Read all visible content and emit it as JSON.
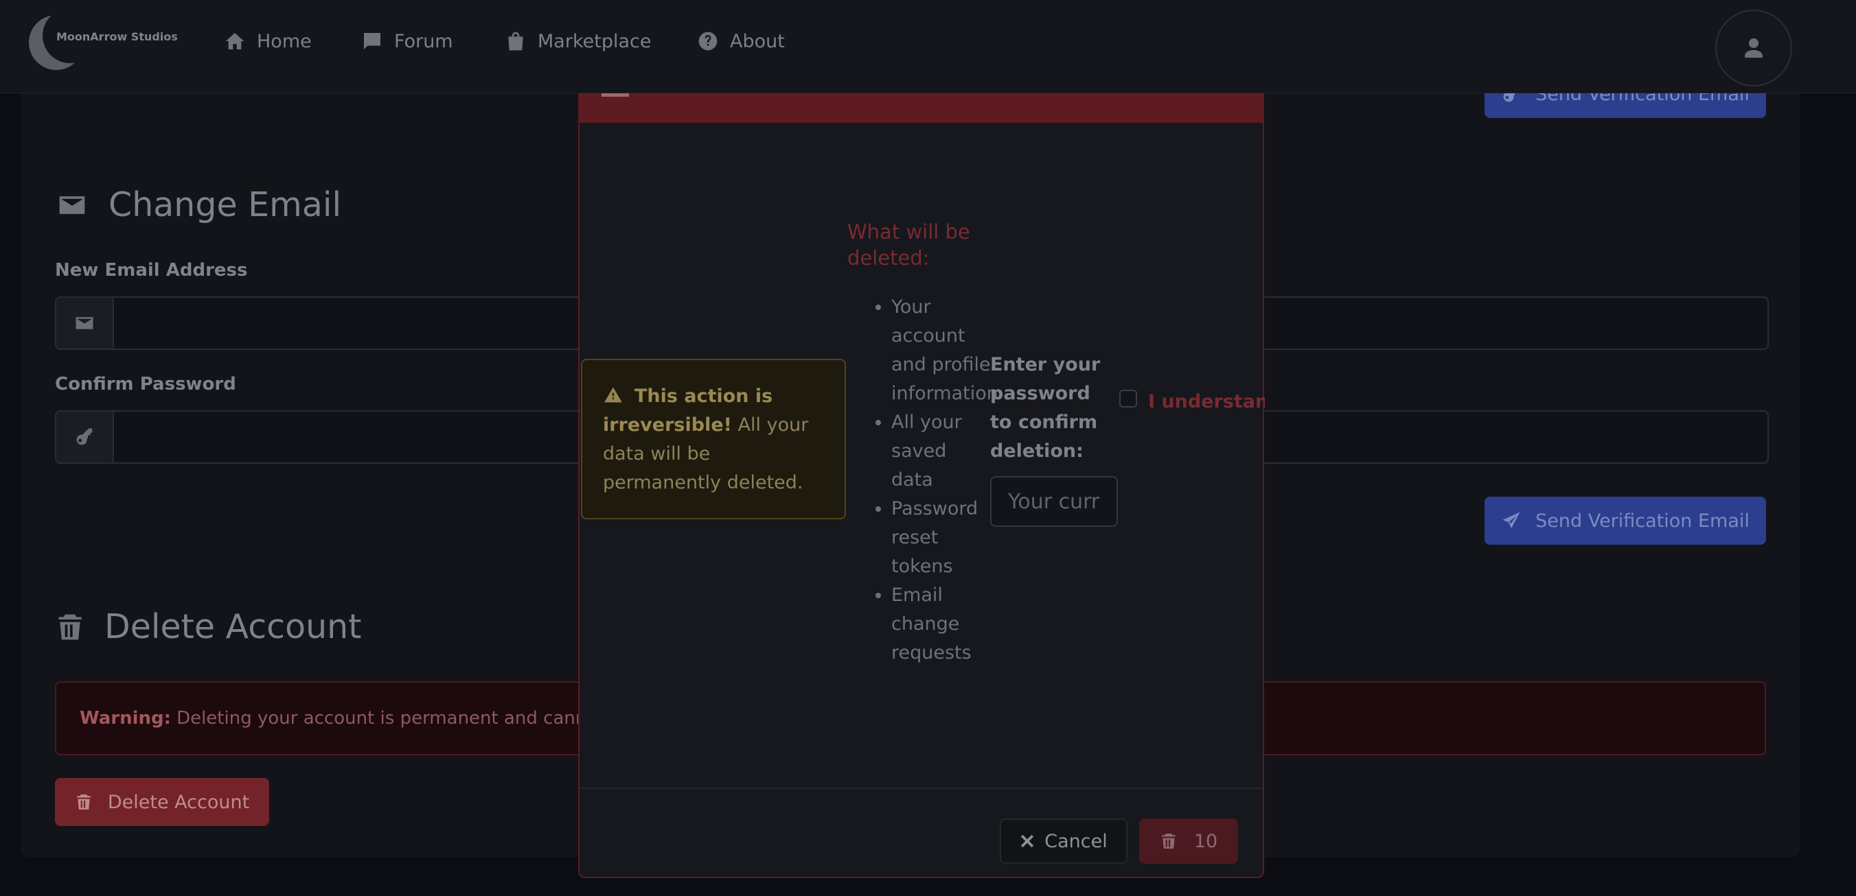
{
  "navbar": {
    "brand": "MoonArrow Studios",
    "links": [
      {
        "label": "Home",
        "icon": "home-icon"
      },
      {
        "label": "Forum",
        "icon": "forum-icon"
      },
      {
        "label": "Marketplace",
        "icon": "shopping-bag-icon"
      },
      {
        "label": "About",
        "icon": "question-circle-icon"
      }
    ]
  },
  "verification": {
    "button_label": "Send Verification Email"
  },
  "change_email": {
    "title": "Change Email",
    "new_email_label": "New Email Address",
    "new_email_value": "",
    "confirm_password_label": "Confirm Password",
    "confirm_password_value": "",
    "submit_label": "Send Verification Email"
  },
  "delete_account": {
    "title": "Delete Account",
    "warning_strong": "Warning:",
    "warning_text": "Deleting your account is permanent and cannot b",
    "button_label": "Delete Account"
  },
  "modal": {
    "alert_strong": "This action is irreversible!",
    "alert_text": "All your data will be permanently deleted.",
    "deleted_title": "What will be deleted:",
    "deleted_items": [
      "Your account and profile information",
      "All your saved data",
      "Password reset tokens",
      "Email change requests"
    ],
    "password_label": "Enter your password to confirm deletion:",
    "password_placeholder": "Your current password",
    "checkbox_label": "I understand this action cannot be undone",
    "cancel_label": "Cancel",
    "confirm_countdown": "10"
  },
  "colors": {
    "accent_blue": "#2c3f8e",
    "danger_red": "#74232a",
    "modal_header": "#5e1b22",
    "warning_yellow": "#51451a"
  }
}
